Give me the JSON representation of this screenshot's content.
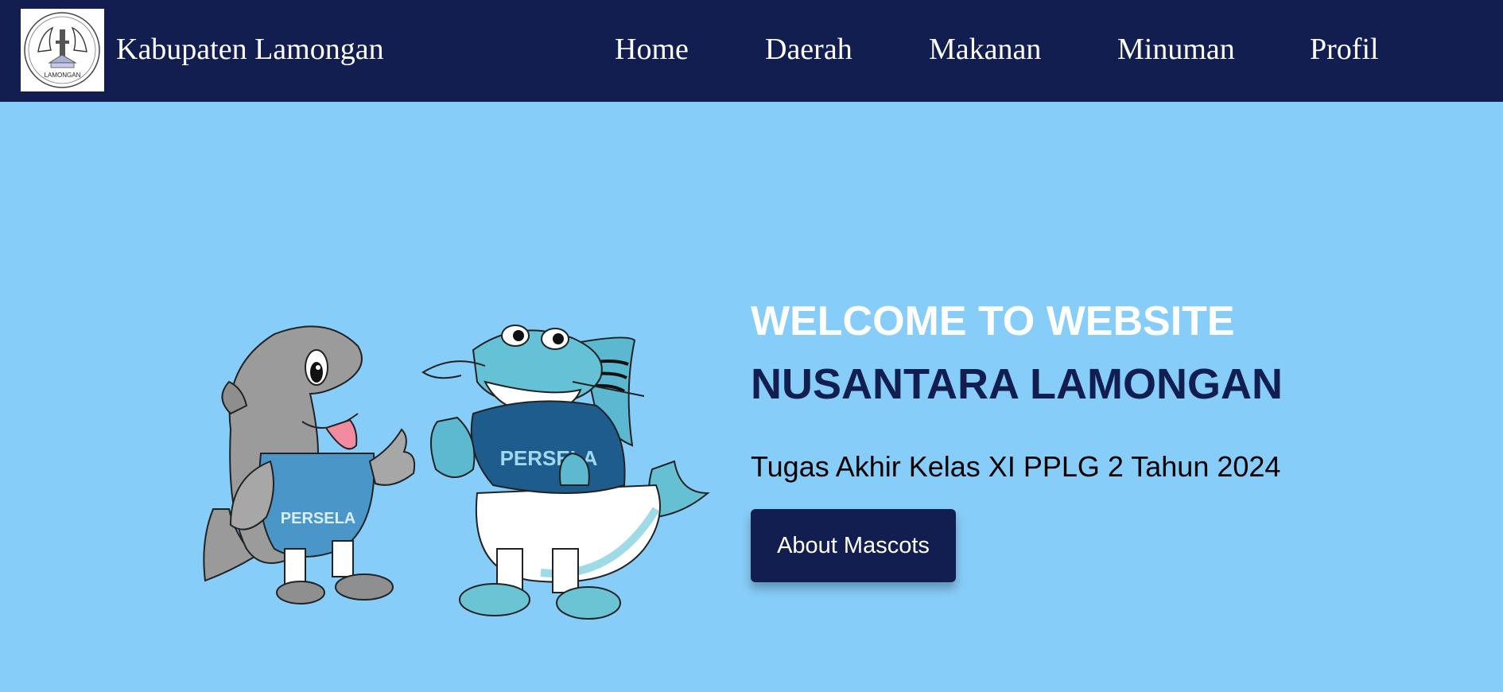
{
  "header": {
    "brand": "Kabupaten Lamongan",
    "logo_text": "LAMONGAN",
    "nav": [
      {
        "label": "Home"
      },
      {
        "label": "Daerah"
      },
      {
        "label": "Makanan"
      },
      {
        "label": "Minuman"
      },
      {
        "label": "Profil"
      }
    ]
  },
  "hero": {
    "title_line1": "WELCOME TO WEBSITE",
    "title_line2": "NUSANTARA LAMONGAN",
    "subtitle": "Tugas Akhir Kelas XI PPLG 2 Tahun 2024",
    "button_label": "About Mascots"
  },
  "mascots": {
    "dolphin_shirt_text": "PERSELA",
    "catfish_shirt_text": "PERSELA"
  },
  "colors": {
    "navbar": "#121e50",
    "background": "#87cdf9",
    "accent": "#121e50",
    "title_light": "#ffffff"
  }
}
